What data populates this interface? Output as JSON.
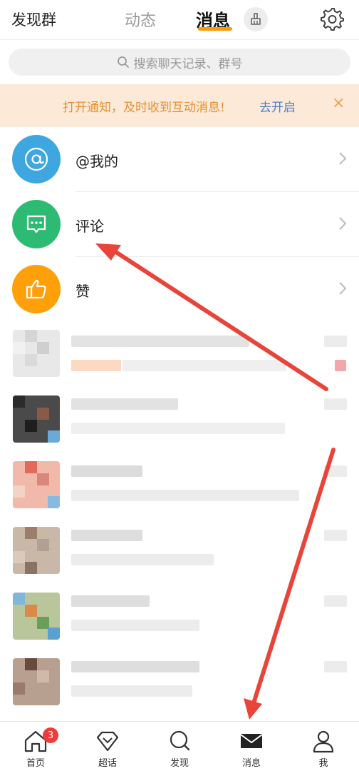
{
  "header": {
    "left_title": "发现群",
    "tab_dynamic": "动态",
    "tab_messages": "消息"
  },
  "search": {
    "placeholder": "搜索聊天记录、群号"
  },
  "notice": {
    "text": "打开通知，及时收到互动消息!",
    "action": "去开启",
    "close": "×"
  },
  "categories": [
    {
      "label": "@我的",
      "icon": "at-icon",
      "color": "#3fa7e0"
    },
    {
      "label": "评论",
      "icon": "comment-icon",
      "color": "#2dbb73"
    },
    {
      "label": "赞",
      "icon": "thumbs-up-icon",
      "color": "#ff9f0a"
    }
  ],
  "tabbar": {
    "home": "首页",
    "home_badge": "3",
    "topics": "超话",
    "discover": "发现",
    "messages": "消息",
    "me": "我"
  },
  "colors": {
    "accent": "#ff9a00",
    "arrow": "#e8443a",
    "notice_bg": "#fde9d8",
    "link": "#4a7fd1"
  }
}
